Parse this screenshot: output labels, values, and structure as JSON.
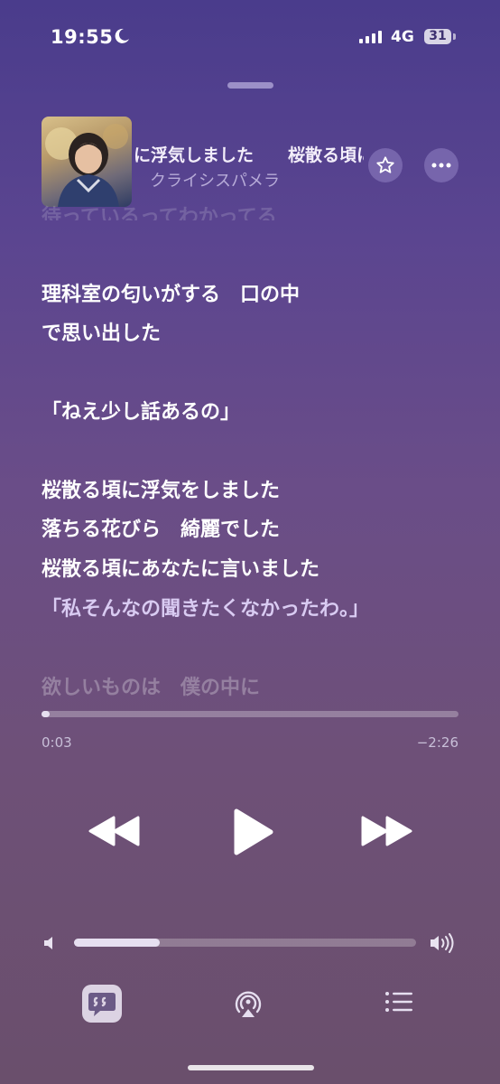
{
  "status_bar": {
    "time": "19:55",
    "network": "4G",
    "battery": "31"
  },
  "now_playing": {
    "title": "に浮気しました　　桜散る頃に浮気しました",
    "artist": "クライシスパメラ"
  },
  "lyrics": {
    "previous_faded": "待っているってわかってる",
    "lines": [
      "理科室の匂いがする　口の中",
      "で思い出した",
      "「ねえ少し話あるの」",
      "桜散る頃に浮気をしました",
      "落ちる花びら　綺麗でした",
      "桜散る頃にあなたに言いました",
      "「私そんなの聞きたくなかったわ。」",
      "欲しいものは　僕の中に"
    ]
  },
  "progress": {
    "elapsed": "0:03",
    "remaining": "−2:26",
    "fraction": 0.02
  },
  "volume": {
    "fraction": 0.25
  },
  "icons": [
    "moon-icon",
    "signal-icon",
    "star-icon",
    "more-icon",
    "rewind-icon",
    "play-icon",
    "forward-icon",
    "volume-low-icon",
    "volume-high-icon",
    "lyrics-icon",
    "airplay-icon",
    "queue-icon"
  ],
  "colors": {
    "accent": "#ffffff",
    "background_top": "#4a3c8c",
    "background_bottom": "#6a4f6c"
  }
}
